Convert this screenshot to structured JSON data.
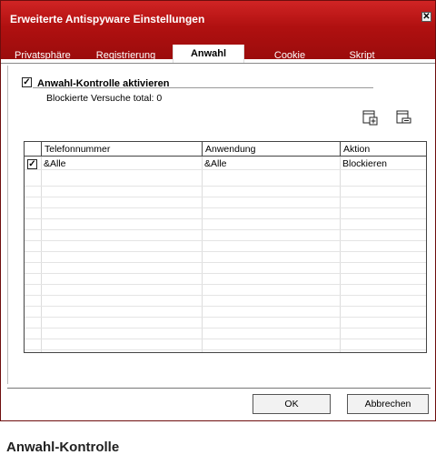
{
  "window": {
    "title": "Erweiterte Antispyware Einstellungen",
    "close_symbol": "✕"
  },
  "tabs": [
    {
      "label": "Privatsphäre",
      "active": false
    },
    {
      "label": "Registrierung",
      "active": false
    },
    {
      "label": "Anwahl",
      "active": true
    },
    {
      "label": "Cookie",
      "active": false
    },
    {
      "label": "Skript",
      "active": false
    }
  ],
  "dial_control": {
    "enable_label": "Anwahl-Kontrolle aktivieren",
    "enabled": true,
    "blocked_attempts_label": "Blockierte Versuche total: 0"
  },
  "toolbar": {
    "add_icon": "add-entry-icon",
    "remove_icon": "remove-entry-icon"
  },
  "table": {
    "columns": [
      "Telefonnummer",
      "Anwendung",
      "Aktion"
    ],
    "rows": [
      {
        "checked": true,
        "phone": "&Alle",
        "application": "&Alle",
        "action": "Blockieren"
      }
    ]
  },
  "buttons": {
    "ok": "OK",
    "cancel": "Abbrechen"
  },
  "caption": "Anwahl-Kontrolle",
  "colors": {
    "titlebar": "#b01010",
    "accent": "#9b0c0c"
  }
}
